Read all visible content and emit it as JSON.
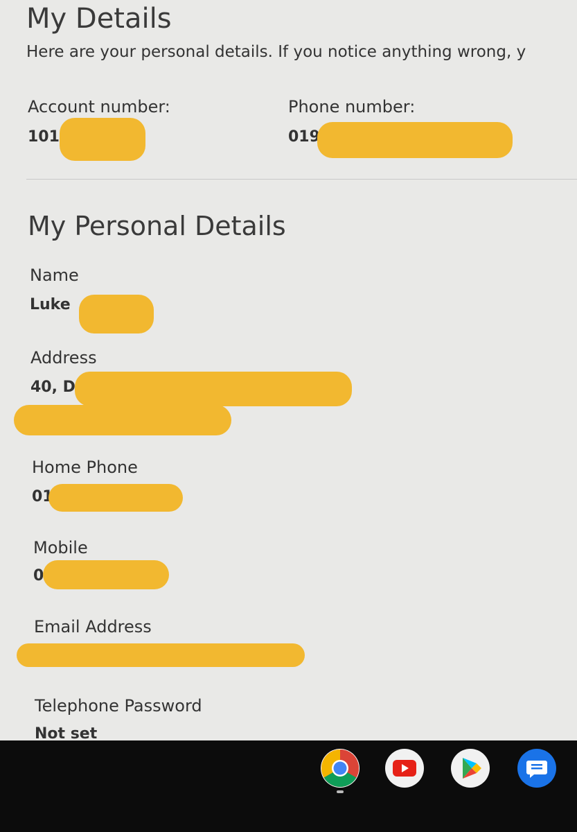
{
  "header": {
    "title": "My Details",
    "intro": "Here are your personal details. If you notice anything wrong, y"
  },
  "account": {
    "account_number_label": "Account number:",
    "account_number_value": "101",
    "phone_number_label": "Phone number:",
    "phone_number_value": "019"
  },
  "personal": {
    "title": "My Personal Details",
    "name_label": "Name",
    "name_value": "Luke",
    "address_label": "Address",
    "address_value": "40, D",
    "home_phone_label": "Home Phone",
    "home_phone_value": "01",
    "mobile_label": "Mobile",
    "mobile_value": "0",
    "email_label": "Email Address",
    "email_value": "",
    "telephone_password_label": "Telephone Password",
    "telephone_password_value": "Not set"
  },
  "shelf": {
    "apps": [
      {
        "name": "chrome-icon"
      },
      {
        "name": "youtube-icon"
      },
      {
        "name": "play-store-icon"
      },
      {
        "name": "messages-icon"
      }
    ]
  },
  "colors": {
    "page_background": "#e9e9e7",
    "redaction": "#f2b830",
    "text": "#333333",
    "shelf_background": "#0c0c0c"
  }
}
